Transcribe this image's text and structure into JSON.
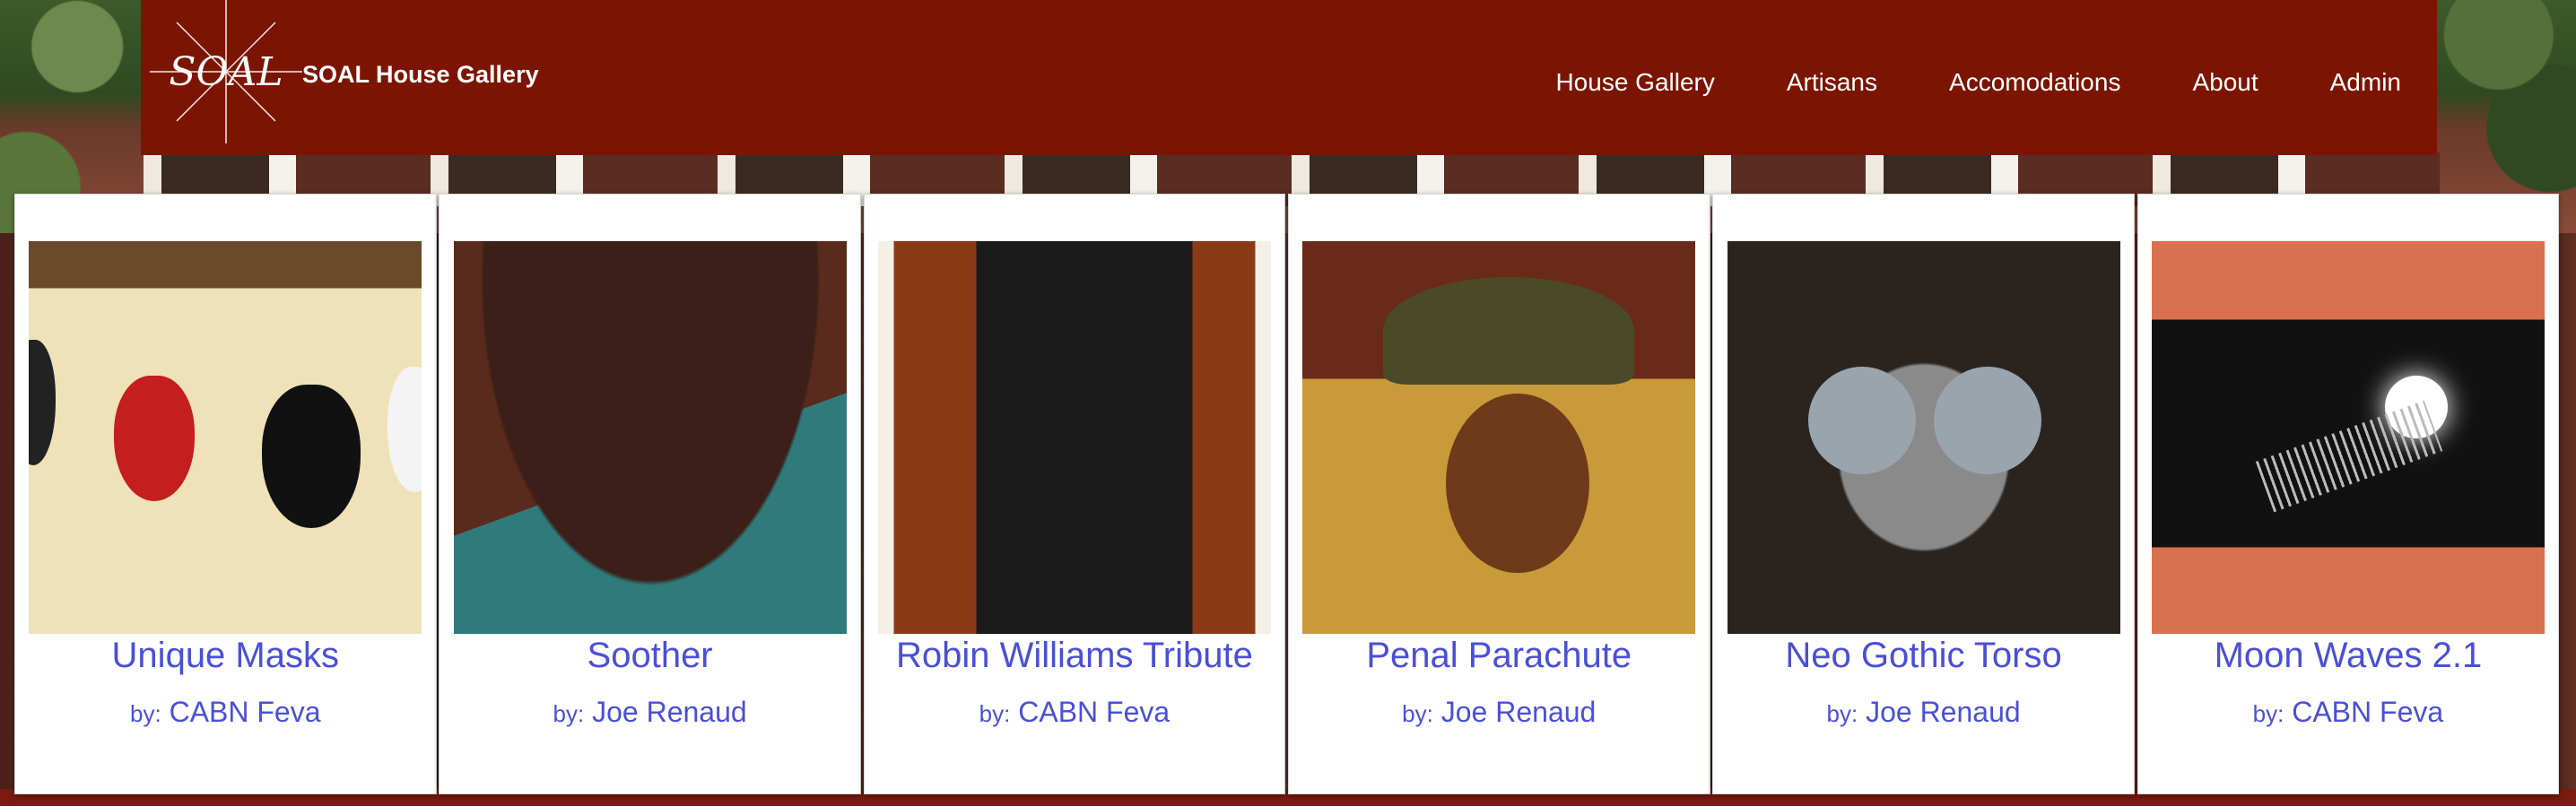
{
  "site": {
    "brand": "SOAL House Gallery",
    "logo_text": "SOAL"
  },
  "nav": {
    "items": [
      {
        "label": "House Gallery"
      },
      {
        "label": "Artisans"
      },
      {
        "label": "Accomodations"
      },
      {
        "label": "About"
      },
      {
        "label": "Admin"
      }
    ]
  },
  "gallery": {
    "items": [
      {
        "title": "Unique Masks",
        "by_label": "by:",
        "artist": "CABN Feva"
      },
      {
        "title": "Soother",
        "by_label": "by:",
        "artist": "Joe Renaud"
      },
      {
        "title": "Robin Williams Tribute",
        "by_label": "by:",
        "artist": "CABN Feva"
      },
      {
        "title": "Penal Parachute",
        "by_label": "by:",
        "artist": "Joe Renaud"
      },
      {
        "title": "Neo Gothic Torso",
        "by_label": "by:",
        "artist": "Joe Renaud"
      },
      {
        "title": "Moon Waves 2.1",
        "by_label": "by:",
        "artist": "CABN Feva"
      }
    ]
  },
  "colors": {
    "navbar_bg": "#7b1502",
    "link": "#4a4fd8"
  }
}
